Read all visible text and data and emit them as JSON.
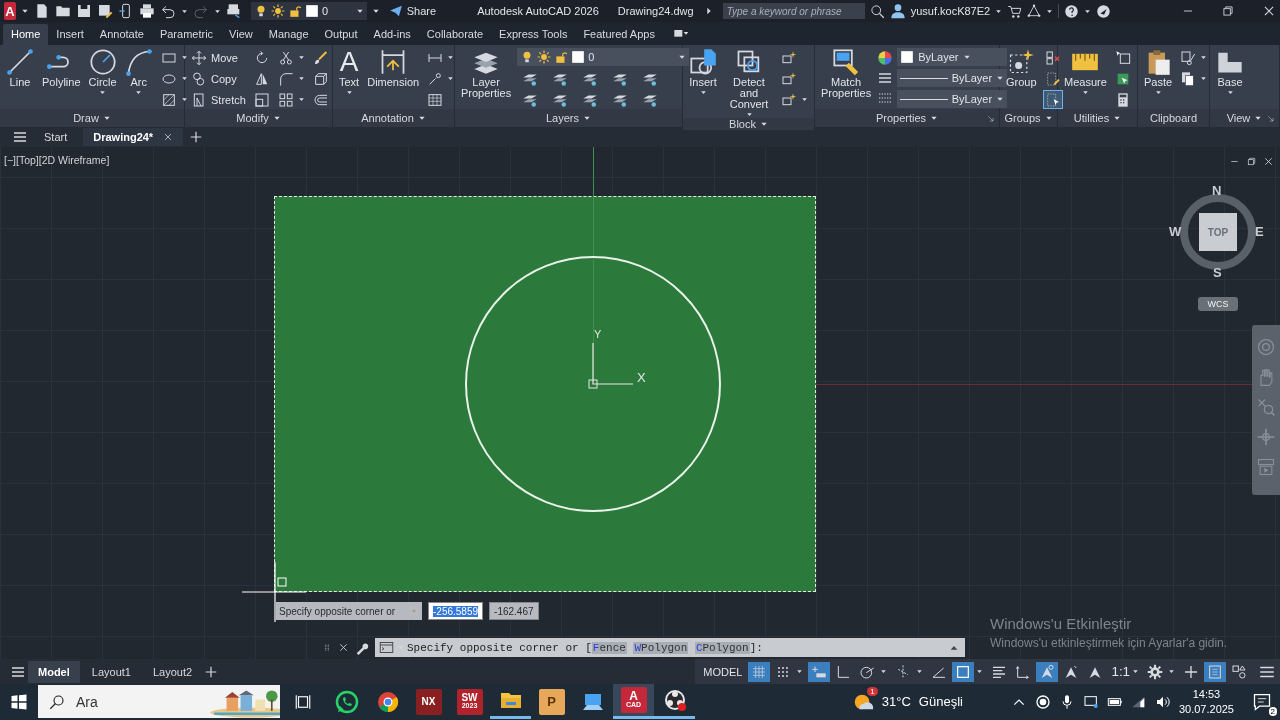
{
  "app_logo": "A",
  "quick_access": {
    "layer": "0",
    "share": "Share"
  },
  "title": {
    "app": "Autodesk AutoCAD 2026",
    "file": "Drawing24.dwg"
  },
  "search": {
    "placeholder": "Type a keyword or phrase"
  },
  "user": "yusuf.kocK87E2",
  "ribbon_tabs": [
    {
      "label": "Home",
      "selected": true
    },
    {
      "label": "Insert",
      "selected": false
    },
    {
      "label": "Annotate",
      "selected": false
    },
    {
      "label": "Parametric",
      "selected": false
    },
    {
      "label": "View",
      "selected": false
    },
    {
      "label": "Manage",
      "selected": false
    },
    {
      "label": "Output",
      "selected": false
    },
    {
      "label": "Add-ins",
      "selected": false
    },
    {
      "label": "Collaborate",
      "selected": false
    },
    {
      "label": "Express Tools",
      "selected": false
    },
    {
      "label": "Featured Apps",
      "selected": false
    }
  ],
  "ribbon_panels": [
    {
      "title": "Draw",
      "dropdown": true,
      "launcher": false,
      "items": [
        {
          "kind": "large",
          "label": "Line",
          "dropdown": false
        },
        {
          "kind": "large",
          "label": "Polyline",
          "dropdown": false
        },
        {
          "kind": "large",
          "label": "Circle",
          "dropdown": true
        },
        {
          "kind": "large",
          "label": "Arc",
          "dropdown": true
        },
        {
          "kind": "stack",
          "rows": [
            {
              "dropdown": true
            },
            {
              "dropdown": true
            },
            {
              "dropdown": true
            }
          ]
        }
      ]
    },
    {
      "title": "Modify",
      "dropdown": true,
      "launcher": false,
      "items": [
        {
          "kind": "stack",
          "rows": [
            {
              "label": "Move",
              "dropdown": false
            },
            {
              "label": "Copy",
              "dropdown": false
            },
            {
              "label": "Stretch",
              "dropdown": false
            }
          ]
        },
        {
          "kind": "stack",
          "rows": [
            {
              "dropdown": false
            },
            {
              "dropdown": false
            },
            {
              "dropdown": false
            }
          ]
        },
        {
          "kind": "stack",
          "rows": [
            {
              "dropdown": true
            },
            {
              "dropdown": true
            },
            {
              "dropdown": true
            }
          ]
        },
        {
          "kind": "stack",
          "rows": [
            {
              "dropdown": false
            },
            {
              "dropdown": false
            },
            {
              "dropdown": false
            }
          ]
        }
      ]
    },
    {
      "title": "Annotation",
      "dropdown": true,
      "launcher": false,
      "items": [
        {
          "kind": "glyph",
          "glyph": "A",
          "label": "Text",
          "dropdown": true
        },
        {
          "kind": "large",
          "label": "Dimension",
          "dropdown": false
        },
        {
          "kind": "stack",
          "rows": [
            {
              "dropdown": true
            },
            {
              "dropdown": true
            },
            {
              "dropdown": false
            }
          ]
        }
      ]
    },
    {
      "title": "Layers",
      "dropdown": true,
      "launcher": false,
      "items": [
        {
          "kind": "large",
          "label": "Layer Properties",
          "dropdown": false
        },
        {
          "kind": "layer",
          "value": "0"
        }
      ]
    },
    {
      "title": "Block",
      "dropdown": true,
      "launcher": false,
      "items": [
        {
          "kind": "large",
          "label": "Insert",
          "dropdown": true
        },
        {
          "kind": "large",
          "label": "Detect and Convert",
          "dropdown": true
        },
        {
          "kind": "stack",
          "rows": [
            {
              "dropdown": false
            },
            {
              "dropdown": false
            },
            {
              "dropdown": true
            }
          ]
        }
      ]
    },
    {
      "title": "Properties",
      "dropdown": true,
      "launcher": true,
      "items": [
        {
          "kind": "large",
          "label": "Match Properties",
          "dropdown": false
        },
        {
          "kind": "fields",
          "rows": [
            {
              "value": "ByLayer"
            },
            {
              "value": "ByLayer"
            },
            {
              "value": "ByLayer"
            }
          ]
        }
      ]
    },
    {
      "title": "Groups",
      "dropdown": true,
      "launcher": false,
      "items": [
        {
          "kind": "large",
          "label": "Group",
          "dropdown": false
        },
        {
          "kind": "stack",
          "rows": [
            {
              "dropdown": false,
              "on": false
            },
            {
              "dropdown": false,
              "on": false
            },
            {
              "dropdown": false,
              "on": true
            }
          ]
        }
      ]
    },
    {
      "title": "Utilities",
      "dropdown": true,
      "launcher": false,
      "items": [
        {
          "kind": "large",
          "label": "Measure",
          "dropdown": true
        },
        {
          "kind": "stack",
          "rows": [
            {
              "dropdown": false
            },
            {
              "dropdown": false
            },
            {
              "dropdown": false
            }
          ]
        }
      ]
    },
    {
      "title": "Clipboard",
      "dropdown": false,
      "launcher": false,
      "items": [
        {
          "kind": "large",
          "label": "Paste",
          "dropdown": true
        },
        {
          "kind": "stack",
          "rows": [
            {
              "dropdown": true
            },
            {
              "dropdown": true
            }
          ]
        }
      ]
    },
    {
      "title": "View",
      "dropdown": true,
      "launcher": true,
      "items": [
        {
          "kind": "large",
          "label": "Base",
          "dropdown": true
        }
      ]
    }
  ],
  "file_tabs": [
    {
      "label": "Start",
      "selected": false
    },
    {
      "label": "Drawing24*",
      "selected": true
    }
  ],
  "viewport": {
    "label": "[−][Top][2D Wireframe]",
    "ucs": {
      "x": "X",
      "y": "Y"
    },
    "viewcube": {
      "top": "TOP",
      "north": "N",
      "south": "S",
      "east": "E",
      "west": "W",
      "coordinate_system": "WCS"
    }
  },
  "dynamic_input": {
    "prompt": "Specify opposite corner or",
    "values": [
      {
        "text": "-256.5859",
        "selected": true
      },
      {
        "text": "-162.467",
        "selected": false
      }
    ]
  },
  "command_line": {
    "prompt": "Specify opposite corner or [",
    "options": [
      {
        "key": "F",
        "rest": "ence"
      },
      {
        "key": "W",
        "rest": "Polygon"
      },
      {
        "key": "C",
        "rest": "Polygon"
      }
    ],
    "suffix": "]:"
  },
  "activation_notice": {
    "title": "Windows'u Etkinleştir",
    "message": "Windows'u etkinleştirmek için Ayarlar'a gidin."
  },
  "layout_tabs": [
    {
      "label": "Model",
      "selected": true
    },
    {
      "label": "Layout1",
      "selected": false
    },
    {
      "label": "Layout2",
      "selected": false
    }
  ],
  "status_bar": {
    "space": "MODEL",
    "toggles": [
      {
        "on": true,
        "dropdown": false
      },
      {
        "on": false,
        "dropdown": true
      },
      {
        "on": true,
        "dropdown": false
      },
      {
        "on": false,
        "dropdown": false
      },
      {
        "on": false,
        "dropdown": true
      },
      {
        "on": false,
        "dropdown": true
      },
      {
        "on": false,
        "dropdown": false
      },
      {
        "on": true,
        "dropdown": true
      },
      {
        "on": false,
        "dropdown": false
      },
      {
        "on": false,
        "dropdown": false
      },
      {
        "on": true,
        "dropdown": false
      },
      {
        "on": false,
        "dropdown": false
      },
      {
        "on": false,
        "dropdown": false
      }
    ],
    "scale": "1:1",
    "tools": [
      {
        "on": false,
        "dropdown": true
      },
      {
        "on": false,
        "dropdown": false
      },
      {
        "on": true,
        "dropdown": false
      },
      {
        "on": false,
        "dropdown": false
      }
    ]
  },
  "taskbar": {
    "search": {
      "placeholder": "Ara"
    },
    "apps": [
      {
        "running": false,
        "selected": false
      },
      {
        "running": false,
        "selected": false
      },
      {
        "letters": "NX",
        "running": false,
        "selected": false
      },
      {
        "letters": "SW",
        "sub": "2023",
        "running": false,
        "selected": false
      },
      {
        "running": true,
        "selected": false
      },
      {
        "letters": "P",
        "running": false,
        "selected": false
      },
      {
        "running": false,
        "selected": false
      },
      {
        "letters": "A",
        "sub": "CAD",
        "running": true,
        "selected": true
      },
      {
        "running": true,
        "selected": false
      }
    ],
    "weather": {
      "badge": "1",
      "temperature": "31°C",
      "condition": "Güneşli"
    },
    "time": "14:53",
    "date": "30.07.2025",
    "notifications": "2"
  }
}
